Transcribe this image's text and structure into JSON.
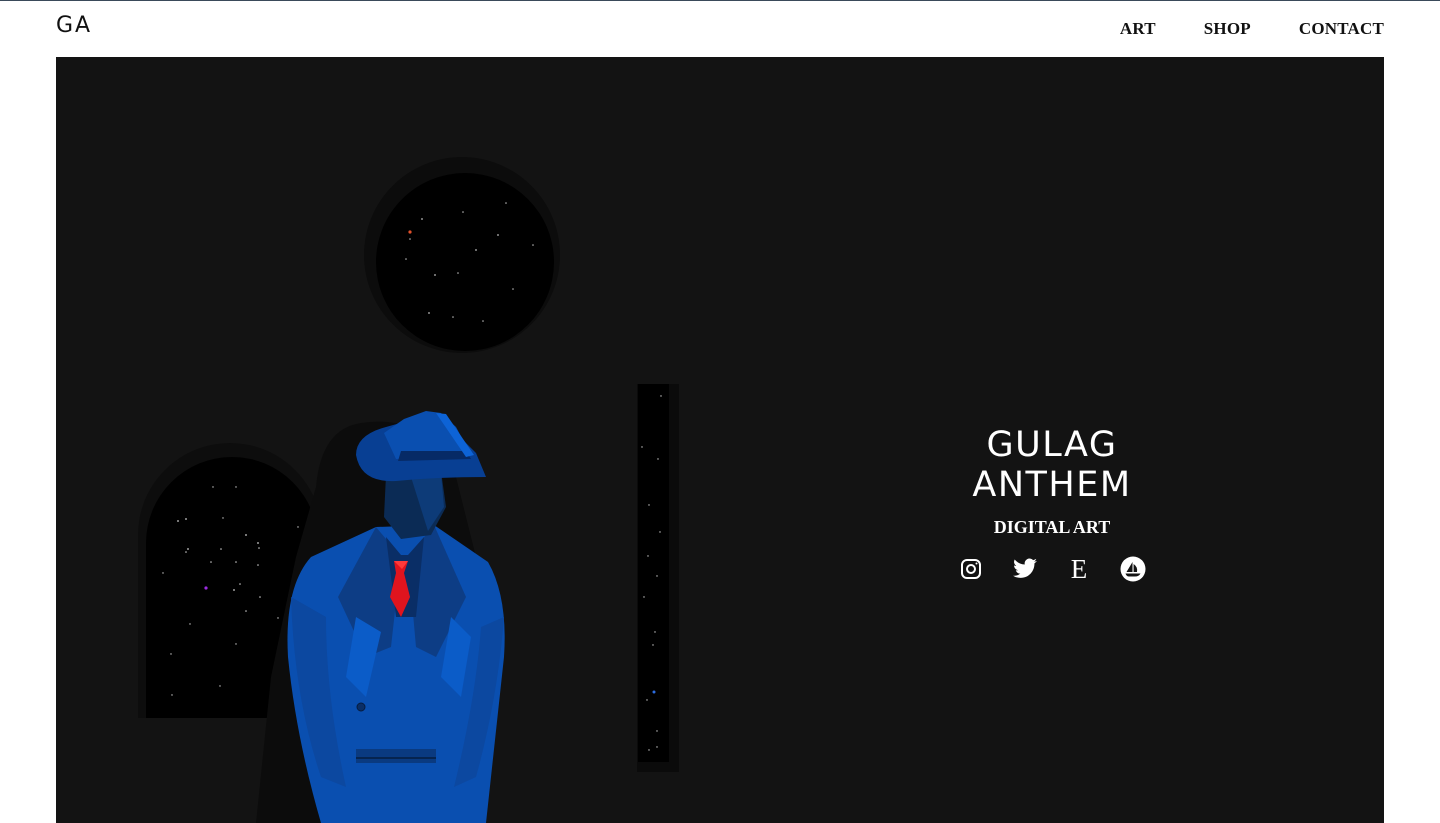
{
  "header": {
    "logo": "GA",
    "nav": [
      {
        "label": "ART"
      },
      {
        "label": "SHOP"
      },
      {
        "label": "CONTACT"
      }
    ]
  },
  "hero": {
    "title": "GULAG ANTHEM",
    "subtitle": "DIGITAL ART",
    "socials": [
      {
        "icon": "instagram-icon"
      },
      {
        "icon": "twitter-icon"
      },
      {
        "icon": "etsy-icon",
        "glyph": "E"
      },
      {
        "icon": "opensea-icon"
      }
    ]
  },
  "colors": {
    "hero_background": "#131313",
    "figure_blue": "#0a4fb0",
    "tie_red": "#e0141e",
    "header_text": "#111111"
  }
}
